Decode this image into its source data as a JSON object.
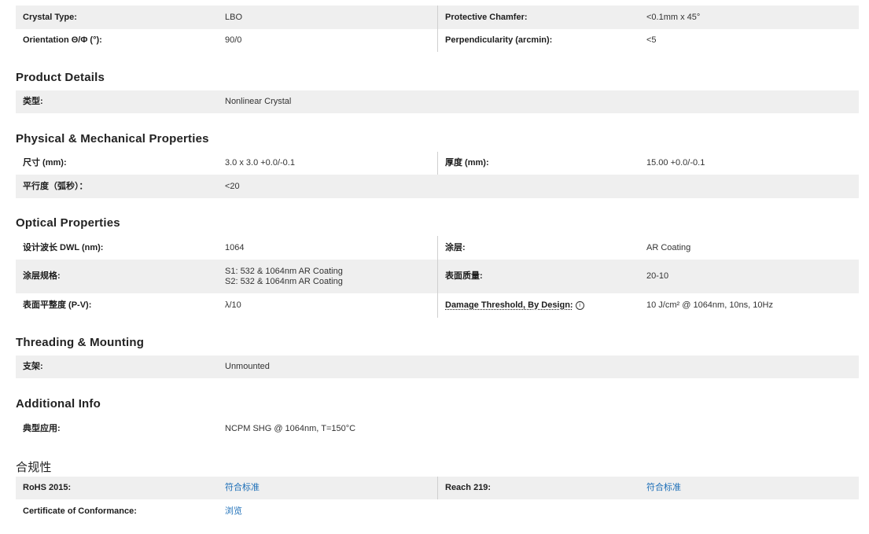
{
  "top": {
    "rows": [
      {
        "l1": "Crystal Type:",
        "v1": "LBO",
        "l2": "Protective Chamfer:",
        "v2": "<0.1mm x 45°"
      },
      {
        "l1": "Orientation Θ/Φ (°):",
        "v1": "90/0",
        "l2": "Perpendicularity (arcmin):",
        "v2": "<5"
      }
    ]
  },
  "product": {
    "title": "Product Details",
    "type_label": "类型:",
    "type_value": "Nonlinear Crystal"
  },
  "physical": {
    "title": "Physical & Mechanical Properties",
    "size_label": "尺寸 (mm):",
    "size_value": "3.0 x 3.0 +0.0/-0.1",
    "thickness_label": "厚度 (mm):",
    "thickness_value": "15.00 +0.0/-0.1",
    "parallelism_label": "平行度（弧秒）：",
    "parallelism_value": "<20"
  },
  "optical": {
    "title": "Optical Properties",
    "dwl_label": "设计波长 DWL (nm):",
    "dwl_value": "1064",
    "coating_label": "涂层:",
    "coating_value": "AR Coating",
    "coating_spec_label": "涂层规格:",
    "coating_spec_line1": "S1: 532 & 1064nm AR Coating",
    "coating_spec_line2": "S2: 532 & 1064nm AR Coating",
    "surface_quality_label": "表面质量:",
    "surface_quality_value": "20-10",
    "flatness_label": "表面平整度 (P-V):",
    "flatness_value": "λ/10",
    "damage_label": "Damage Threshold, By Design:",
    "damage_icon": "info-icon",
    "damage_icon_glyph": "i",
    "damage_value": "10 J/cm² @ 1064nm, 10ns, 10Hz"
  },
  "threading": {
    "title": "Threading & Mounting",
    "mount_label": "支架:",
    "mount_value": "Unmounted"
  },
  "additional": {
    "title": "Additional Info",
    "app_label": "典型应用:",
    "app_value": "NCPM SHG @ 1064nm, T=150°C"
  },
  "compliance": {
    "title": "合规性",
    "rohs_label": "RoHS 2015:",
    "rohs_value": "符合标准",
    "reach_label": "Reach 219:",
    "reach_value": "符合标准",
    "coc_label": "Certificate of Conformance:",
    "coc_value": "浏览"
  },
  "colors": {
    "shaded_row": "#efefef",
    "link": "#1d6fb8",
    "divider": "#cfcfcf"
  }
}
